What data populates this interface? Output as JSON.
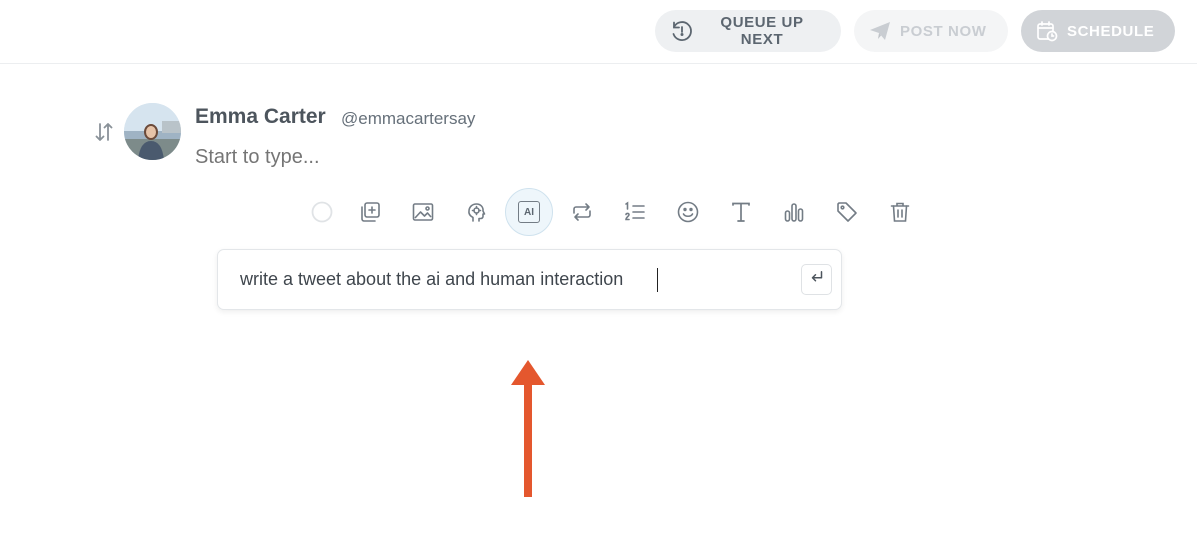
{
  "header": {
    "queue_label": "QUEUE UP NEXT",
    "post_label": "POST NOW",
    "schedule_label": "SCHEDULE"
  },
  "composer": {
    "author_name": "Emma Carter",
    "author_handle": "@emmacartersay",
    "placeholder": "Start to type..."
  },
  "toolbar": {
    "items": [
      {
        "icon": "circle-icon"
      },
      {
        "icon": "add-thread-icon"
      },
      {
        "icon": "image-icon"
      },
      {
        "icon": "idea-head-icon"
      },
      {
        "icon": "ai-icon",
        "label": "AI",
        "active": true
      },
      {
        "icon": "repeat-icon"
      },
      {
        "icon": "numbered-list-icon"
      },
      {
        "icon": "emoji-icon"
      },
      {
        "icon": "text-format-icon"
      },
      {
        "icon": "poll-icon"
      },
      {
        "icon": "tag-icon"
      },
      {
        "icon": "trash-icon"
      }
    ]
  },
  "ai_prompt": {
    "value": "write a tweet about the ai and human interaction",
    "submit_icon": "enter-icon"
  },
  "colors": {
    "annotation_arrow": "#e4572e",
    "queue_bg": "#eef0f2",
    "schedule_bg": "#d1d4d8"
  }
}
